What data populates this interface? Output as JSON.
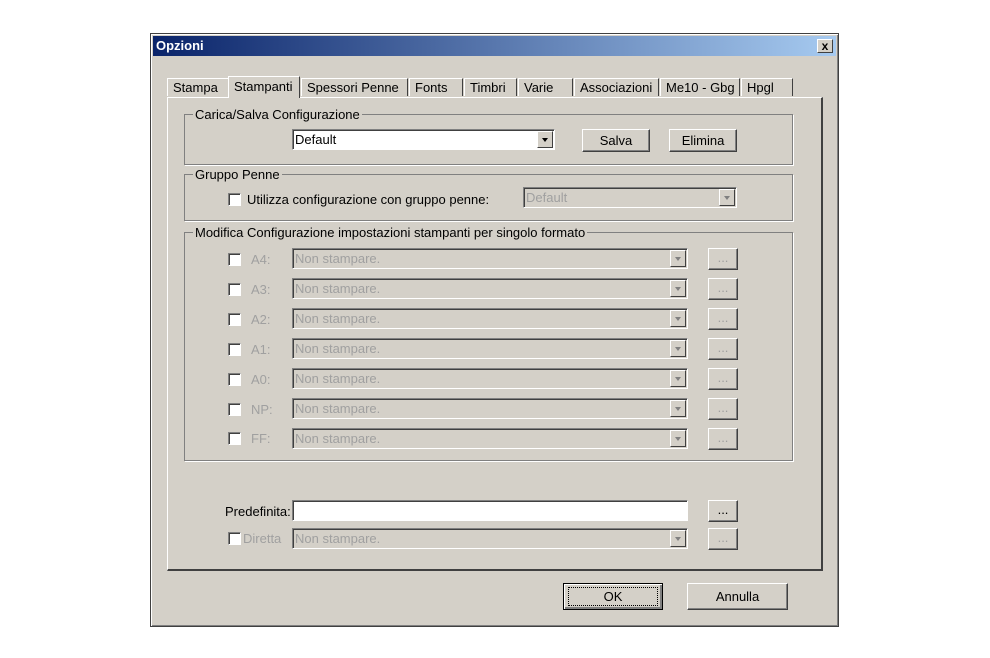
{
  "window": {
    "title": "Opzioni",
    "close_label": "x"
  },
  "tabs": [
    {
      "label": "Stampa"
    },
    {
      "label": "Stampanti"
    },
    {
      "label": "Spessori Penne"
    },
    {
      "label": "Fonts"
    },
    {
      "label": "Timbri"
    },
    {
      "label": "Varie"
    },
    {
      "label": "Associazioni"
    },
    {
      "label": "Me10 - Gbg"
    },
    {
      "label": "Hpgl"
    }
  ],
  "active_tab": "Stampanti",
  "config_group": {
    "title": "Carica/Salva Configurazione",
    "selected": "Default",
    "save_label": "Salva",
    "delete_label": "Elimina"
  },
  "pen_group": {
    "title": "Gruppo Penne",
    "checkbox_label": "Utilizza configurazione con gruppo penne:",
    "checked": false,
    "selected": "Default"
  },
  "format_group": {
    "title": "Modifica Configurazione impostazioni stampanti per singolo formato",
    "rows": [
      {
        "label": "A4:",
        "value": "Non stampare.",
        "browse": "..."
      },
      {
        "label": "A3:",
        "value": "Non stampare.",
        "browse": "..."
      },
      {
        "label": "A2:",
        "value": "Non stampare.",
        "browse": "..."
      },
      {
        "label": "A1:",
        "value": "Non stampare.",
        "browse": "..."
      },
      {
        "label": "A0:",
        "value": "Non stampare.",
        "browse": "..."
      },
      {
        "label": "NP:",
        "value": "Non stampare.",
        "browse": "..."
      },
      {
        "label": "FF:",
        "value": "Non stampare.",
        "browse": "..."
      }
    ]
  },
  "default_printer": {
    "label": "Predefinita:",
    "value": "",
    "browse": "..."
  },
  "direct": {
    "label": "Diretta",
    "value": "Non stampare.",
    "browse": "..."
  },
  "buttons": {
    "ok": "OK",
    "cancel": "Annulla"
  }
}
